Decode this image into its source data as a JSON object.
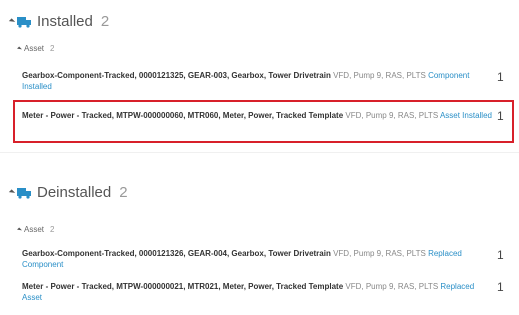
{
  "installed": {
    "title": "Installed",
    "count": "2",
    "icon": "installed-truck-icon",
    "accent": "#2a8fc7",
    "asset_group": {
      "label": "Asset",
      "count": "2"
    },
    "items": [
      {
        "name": "Gearbox-Component-Tracked, 0000121325, GEAR-003, Gearbox, Tower Drivetrain",
        "meta": " VFD, Pump 9, RAS, PLTS ",
        "status": "Component Installed",
        "count": "1"
      },
      {
        "name": "Meter - Power - Tracked, MTPW-000000060, MTR060, Meter, Power, Tracked Template",
        "meta": " VFD, Pump 9, RAS, PLTS ",
        "status": "Asset Installed",
        "count": "1"
      }
    ]
  },
  "deinstalled": {
    "title": "Deinstalled",
    "count": "2",
    "icon": "deinstalled-truck-icon",
    "accent": "#2a8fc7",
    "asset_group": {
      "label": "Asset",
      "count": "2"
    },
    "items": [
      {
        "name": "Gearbox-Component-Tracked, 0000121326, GEAR-004, Gearbox, Tower Drivetrain",
        "meta": " VFD, Pump 9, RAS, PLTS ",
        "status": "Replaced Component",
        "count": "1"
      },
      {
        "name": "Meter - Power - Tracked, MTPW-000000021, MTR021, Meter, Power, Tracked Template",
        "meta": " VFD, Pump 9, RAS, PLTS ",
        "status": "Replaced Asset",
        "count": "1"
      }
    ]
  },
  "highlight_color": "#d8202a"
}
